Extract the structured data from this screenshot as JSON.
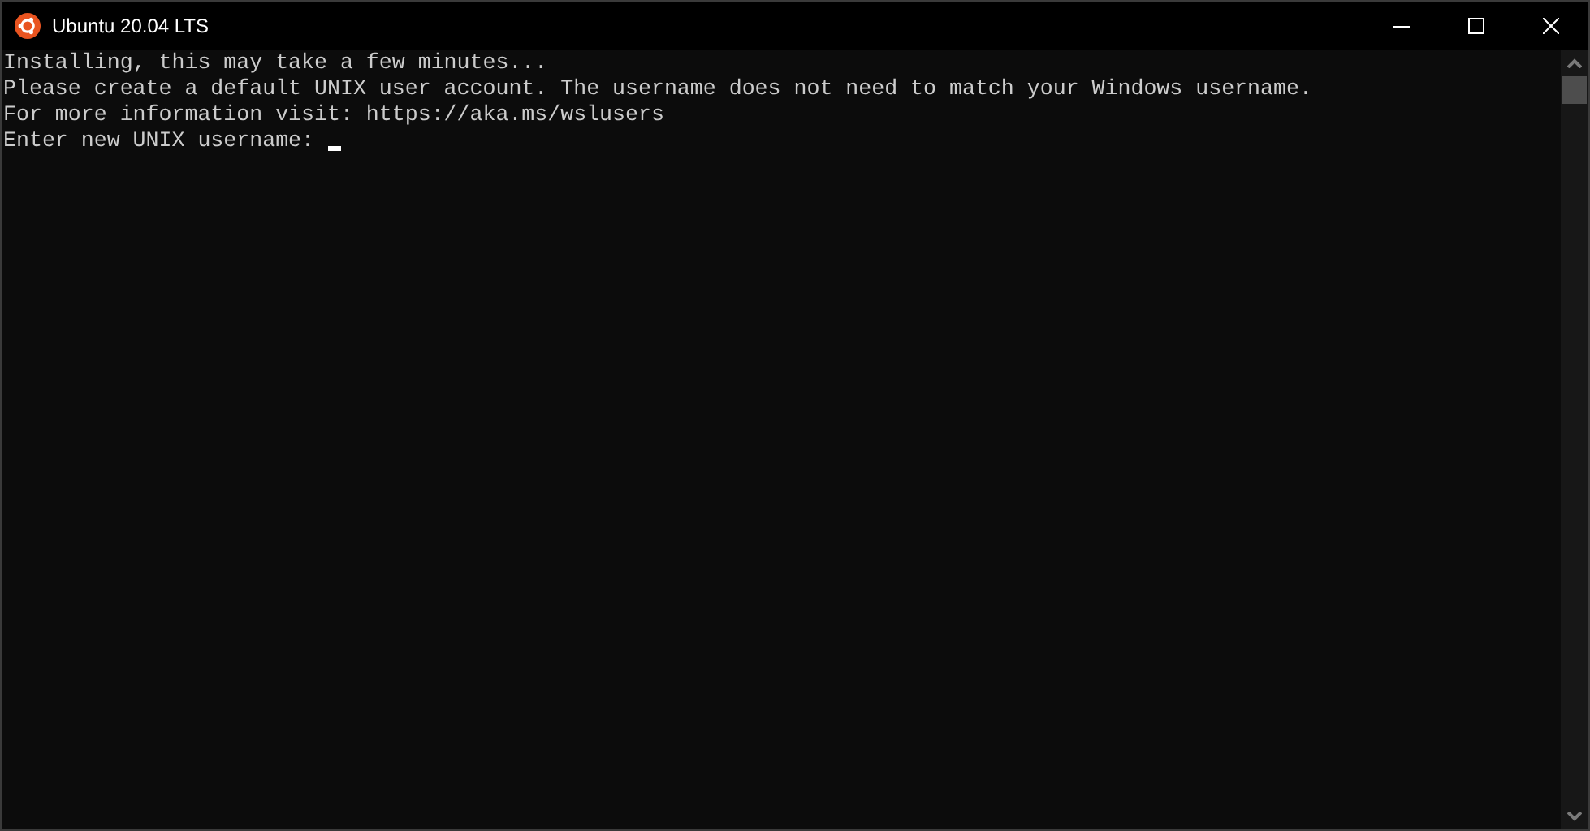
{
  "window": {
    "title": "Ubuntu 20.04 LTS"
  },
  "terminal": {
    "lines": [
      "Installing, this may take a few minutes...",
      "Please create a default UNIX user account. The username does not need to match your Windows username.",
      "For more information visit: https://aka.ms/wslusers"
    ],
    "prompt": "Enter new UNIX username: "
  }
}
